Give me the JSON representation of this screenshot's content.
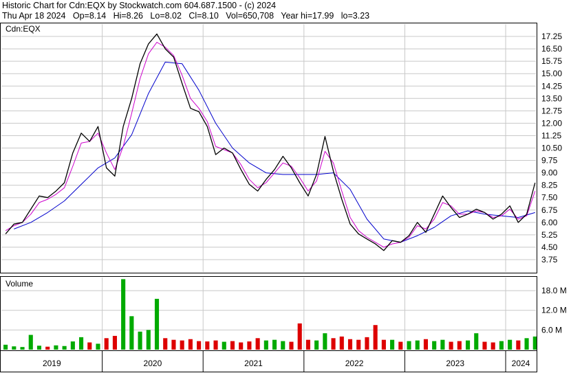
{
  "header": {
    "line1": "Historic Chart for Cdn:EQX by Stockwatch.com 604.687.1500 - (c) 2024",
    "line2": "Thu Apr 18 2024   Op=8.14   Hi=8.26   Lo=8.02   Cl=8.10   Vol=650,708   Year hi=17.99   lo=3.23"
  },
  "price_panel": {
    "label": "Cdn:EQX"
  },
  "volume_panel": {
    "label": "Volume"
  },
  "colors": {
    "price_line": "#000000",
    "ma_short": "#cc00cc",
    "ma_long": "#0000cc",
    "volume_up": "#00aa00",
    "volume_down": "#dd0000",
    "grid": "#c8c8c8"
  },
  "chart_data": [
    {
      "type": "line",
      "title": "Cdn:EQX",
      "x_start": "2019-01",
      "x_end": "2024-04",
      "ylim": [
        3.0,
        18.0
      ],
      "y_ticks": [
        "17.25",
        "16.50",
        "15.75",
        "15.00",
        "14.25",
        "13.50",
        "12.75",
        "12.00",
        "11.25",
        "10.50",
        "9.75",
        "9.00",
        "8.25",
        "7.50",
        "6.75",
        "6.00",
        "5.25",
        "4.50",
        "3.75"
      ],
      "x_ticks": [
        "2019",
        "2020",
        "2021",
        "2022",
        "2023",
        "2024"
      ],
      "series": [
        {
          "style": "price",
          "x": [
            "2019-01",
            "2019-02",
            "2019-03",
            "2019-04",
            "2019-05",
            "2019-06",
            "2019-07",
            "2019-08",
            "2019-09",
            "2019-10",
            "2019-11",
            "2019-12",
            "2020-01",
            "2020-02",
            "2020-03",
            "2020-04",
            "2020-05",
            "2020-06",
            "2020-07",
            "2020-08",
            "2020-09",
            "2020-10",
            "2020-11",
            "2020-12",
            "2021-01",
            "2021-02",
            "2021-03",
            "2021-04",
            "2021-05",
            "2021-06",
            "2021-07",
            "2021-08",
            "2021-09",
            "2021-10",
            "2021-11",
            "2021-12",
            "2022-01",
            "2022-02",
            "2022-03",
            "2022-04",
            "2022-05",
            "2022-06",
            "2022-07",
            "2022-08",
            "2022-09",
            "2022-10",
            "2022-11",
            "2022-12",
            "2023-01",
            "2023-02",
            "2023-03",
            "2023-04",
            "2023-05",
            "2023-06",
            "2023-07",
            "2023-08",
            "2023-09",
            "2023-10",
            "2023-11",
            "2023-12",
            "2024-01",
            "2024-02",
            "2024-03",
            "2024-04"
          ],
          "values": [
            5.3,
            5.9,
            6.0,
            6.8,
            7.6,
            7.5,
            7.9,
            8.4,
            10.2,
            11.4,
            10.9,
            11.8,
            9.3,
            8.8,
            11.8,
            13.5,
            15.6,
            16.8,
            17.4,
            16.5,
            16.0,
            14.4,
            12.9,
            12.7,
            11.8,
            10.1,
            10.5,
            10.2,
            9.2,
            8.3,
            7.9,
            8.6,
            9.2,
            10.0,
            9.3,
            8.4,
            7.6,
            8.9,
            11.2,
            9.1,
            7.4,
            5.9,
            5.3,
            5.0,
            4.7,
            4.3,
            4.9,
            4.8,
            5.2,
            6.0,
            5.4,
            6.5,
            7.6,
            6.9,
            6.3,
            6.5,
            6.8,
            6.6,
            6.2,
            6.5,
            7.0,
            6.0,
            6.5,
            8.4
          ]
        },
        {
          "style": "short_ma",
          "x": [
            "2019-01",
            "2019-02",
            "2019-03",
            "2019-04",
            "2019-05",
            "2019-06",
            "2019-07",
            "2019-08",
            "2019-09",
            "2019-10",
            "2019-11",
            "2019-12",
            "2020-01",
            "2020-02",
            "2020-03",
            "2020-04",
            "2020-05",
            "2020-06",
            "2020-07",
            "2020-08",
            "2020-09",
            "2020-10",
            "2020-11",
            "2020-12",
            "2021-01",
            "2021-02",
            "2021-03",
            "2021-04",
            "2021-05",
            "2021-06",
            "2021-07",
            "2021-08",
            "2021-09",
            "2021-10",
            "2021-11",
            "2021-12",
            "2022-01",
            "2022-02",
            "2022-03",
            "2022-04",
            "2022-05",
            "2022-06",
            "2022-07",
            "2022-08",
            "2022-09",
            "2022-10",
            "2022-11",
            "2022-12",
            "2023-01",
            "2023-02",
            "2023-03",
            "2023-04",
            "2023-05",
            "2023-06",
            "2023-07",
            "2023-08",
            "2023-09",
            "2023-10",
            "2023-11",
            "2023-12",
            "2024-01",
            "2024-02",
            "2024-03",
            "2024-04"
          ],
          "values": [
            5.5,
            5.8,
            6.0,
            6.5,
            7.2,
            7.4,
            7.7,
            8.1,
            9.4,
            10.8,
            10.9,
            11.4,
            10.2,
            9.2,
            10.6,
            12.6,
            14.7,
            16.2,
            16.9,
            16.6,
            16.1,
            14.9,
            13.5,
            12.9,
            12.1,
            10.6,
            10.4,
            10.2,
            9.5,
            8.6,
            8.1,
            8.4,
            9.0,
            9.6,
            9.4,
            8.7,
            7.9,
            8.5,
            10.3,
            9.6,
            7.9,
            6.3,
            5.5,
            5.1,
            4.8,
            4.5,
            4.7,
            4.8,
            5.1,
            5.8,
            5.6,
            6.2,
            7.2,
            7.0,
            6.5,
            6.5,
            6.7,
            6.6,
            6.3,
            6.4,
            6.8,
            6.2,
            6.4,
            7.9
          ]
        },
        {
          "style": "long_ma",
          "x": [
            "2019-02",
            "2019-04",
            "2019-06",
            "2019-08",
            "2019-10",
            "2019-12",
            "2020-02",
            "2020-04",
            "2020-06",
            "2020-08",
            "2020-10",
            "2020-12",
            "2021-02",
            "2021-04",
            "2021-06",
            "2021-08",
            "2021-10",
            "2021-12",
            "2022-02",
            "2022-04",
            "2022-06",
            "2022-08",
            "2022-10",
            "2022-12",
            "2023-02",
            "2023-04",
            "2023-06",
            "2023-08",
            "2023-10",
            "2023-12",
            "2024-02",
            "2024-04"
          ],
          "values": [
            5.6,
            6.0,
            6.6,
            7.3,
            8.3,
            9.3,
            9.9,
            11.3,
            13.8,
            15.7,
            15.6,
            14.0,
            12.0,
            10.5,
            9.6,
            9.0,
            8.9,
            8.9,
            8.9,
            9.0,
            8.0,
            6.2,
            5.0,
            4.8,
            5.2,
            5.7,
            6.4,
            6.7,
            6.5,
            6.4,
            6.3,
            6.6
          ]
        }
      ]
    },
    {
      "type": "bar",
      "title": "Volume",
      "ylim": [
        0,
        22
      ],
      "y_ticks": [
        "18.0 M",
        "12.0 M",
        "6.0 M"
      ],
      "x_ticks": [
        "2019",
        "2020",
        "2021",
        "2022",
        "2023",
        "2024"
      ],
      "x": [
        "2019-01",
        "2019-02",
        "2019-03",
        "2019-04",
        "2019-05",
        "2019-06",
        "2019-07",
        "2019-08",
        "2019-09",
        "2019-10",
        "2019-11",
        "2019-12",
        "2020-01",
        "2020-02",
        "2020-03",
        "2020-04",
        "2020-05",
        "2020-06",
        "2020-07",
        "2020-08",
        "2020-09",
        "2020-10",
        "2020-11",
        "2020-12",
        "2021-01",
        "2021-02",
        "2021-03",
        "2021-04",
        "2021-05",
        "2021-06",
        "2021-07",
        "2021-08",
        "2021-09",
        "2021-10",
        "2021-11",
        "2021-12",
        "2022-01",
        "2022-02",
        "2022-03",
        "2022-04",
        "2022-05",
        "2022-06",
        "2022-07",
        "2022-08",
        "2022-09",
        "2022-10",
        "2022-11",
        "2022-12",
        "2023-01",
        "2023-02",
        "2023-03",
        "2023-04",
        "2023-05",
        "2023-06",
        "2023-07",
        "2023-08",
        "2023-09",
        "2023-10",
        "2023-11",
        "2023-12",
        "2024-01",
        "2024-02",
        "2024-03",
        "2024-04"
      ],
      "values": [
        1.5,
        1.0,
        0.8,
        4.5,
        1.2,
        0.9,
        1.3,
        1.1,
        2.5,
        3.8,
        2.2,
        1.8,
        3.5,
        4.2,
        21.5,
        10.2,
        5.5,
        6.0,
        15.5,
        3.5,
        3.0,
        2.8,
        3.2,
        2.6,
        2.5,
        2.8,
        2.4,
        2.6,
        2.2,
        2.5,
        3.5,
        2.8,
        3.0,
        2.6,
        2.4,
        8.0,
        3.0,
        2.8,
        5.0,
        3.5,
        4.0,
        3.2,
        3.0,
        3.8,
        7.5,
        3.0,
        3.0,
        2.4,
        2.6,
        2.8,
        3.2,
        2.6,
        3.0,
        2.4,
        2.6,
        2.8,
        5.0,
        2.4,
        2.2,
        2.6,
        3.0,
        2.8,
        3.5,
        4.0
      ]
    }
  ]
}
